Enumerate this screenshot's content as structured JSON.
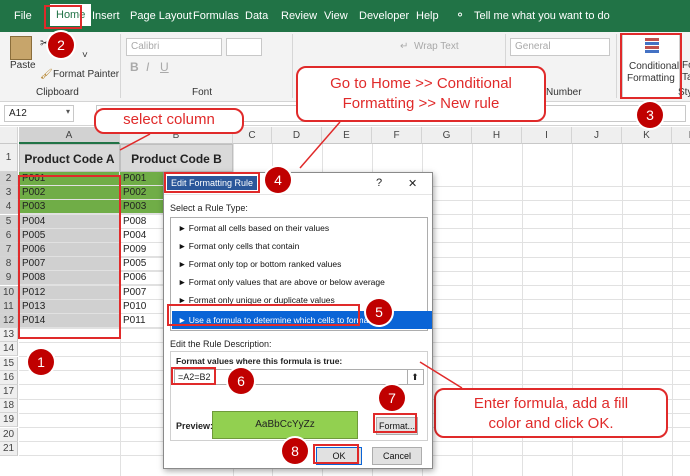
{
  "menubar": {
    "tabs": [
      "File",
      "Home",
      "Insert",
      "Page Layout",
      "Formulas",
      "Data",
      "Review",
      "View",
      "Developer",
      "Help"
    ],
    "tell_me": "Tell me what you want to do"
  },
  "ribbon": {
    "paste": "Paste",
    "format_painter": "Format Painter",
    "clipboard": "Clipboard",
    "font_name": "Calibri",
    "font_group": "Font",
    "wrap_text": "Wrap Text",
    "number_format": "General",
    "number_group": "Number",
    "conditional_formatting_1": "Conditional",
    "conditional_formatting_2": "Formatting",
    "fo": "Fo",
    "ta": "Ta",
    "sty": "Sty"
  },
  "formula_bar": {
    "name_box": "A12"
  },
  "sheet": {
    "columns": [
      "A",
      "B",
      "C",
      "D",
      "E",
      "F",
      "G",
      "H",
      "I",
      "J",
      "K",
      "L"
    ],
    "rows": [
      "1",
      "2",
      "3",
      "4",
      "5",
      "6",
      "7",
      "8",
      "9",
      "10",
      "11",
      "12",
      "13",
      "14",
      "15",
      "16",
      "17",
      "18",
      "19",
      "20",
      "21"
    ],
    "header_a": "Product Code A",
    "header_b": "Product Code B",
    "col_a": [
      "P001",
      "P002",
      "P003",
      "P004",
      "P005",
      "P006",
      "P007",
      "P008",
      "P012",
      "P013",
      "P014"
    ],
    "col_b": [
      "P001",
      "P002",
      "P003",
      "P008",
      "P004",
      "P009",
      "P005",
      "P006",
      "P007",
      "P010",
      "P011"
    ]
  },
  "dialog": {
    "title": "Edit Formatting Rule",
    "help": "?",
    "close": "✕",
    "select_type_label": "Select a Rule Type:",
    "rule_types": [
      "Format all cells based on their values",
      "Format only cells that contain",
      "Format only top or bottom ranked values",
      "Format only values that are above or below average",
      "Format only unique or duplicate values",
      "Use a formula to determine which cells to format"
    ],
    "edit_desc_label": "Edit the Rule Description:",
    "formula_label": "Format values where this formula is true:",
    "formula": "=A2=B2",
    "preview_label": "Preview:",
    "preview_text": "AaBbCcYyZz",
    "format_button": "Format...",
    "ok_button": "OK",
    "cancel_button": "Cancel"
  },
  "annotations": {
    "select_column": "select column",
    "goto_home_1": "Go to Home >> Conditional",
    "goto_home_2": "Formatting >> New rule",
    "enter_formula_1": "Enter formula, add a fill",
    "enter_formula_2": "color and click OK.",
    "steps": [
      "1",
      "2",
      "3",
      "4",
      "5",
      "6",
      "7",
      "8"
    ]
  },
  "colors": {
    "excel_green": "#217346",
    "highlight_green": "#70ad47",
    "preview_fill": "#92d050",
    "annotation_red": "#e02a2a",
    "step_badge": "#c00000",
    "selected_rule": "#0a64d6"
  }
}
